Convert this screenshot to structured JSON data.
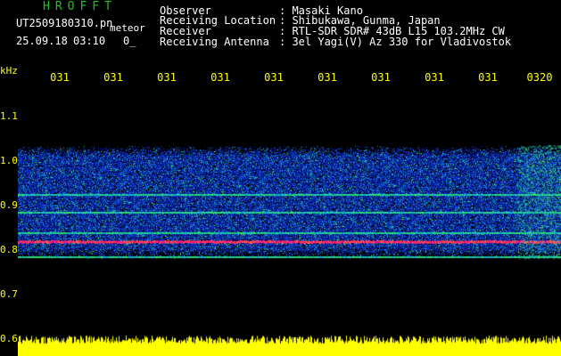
{
  "header": {
    "title": "HROFFT",
    "file_name": "UT2509180310.pn",
    "file_suffix": "meteor",
    "date": "25.09.18",
    "time": "03:10",
    "counter": "0_",
    "fields": [
      {
        "label": "Observer",
        "value": ": Masaki Kano"
      },
      {
        "label": "Receiving Location",
        "value": ": Shibukawa, Gunma, Japan"
      },
      {
        "label": "Receiver",
        "value": ": RTL-SDR SDR# 43dB L15 103.2MHz CW"
      },
      {
        "label": "Receiving Antenna",
        "value": ": 3el Yagi(V) Az 330 for Vladivostok"
      }
    ]
  },
  "axes": {
    "y_unit": "kHz",
    "y_ticks": [
      "1.1",
      "1.0",
      "0.9",
      "0.8",
      "0.7",
      "0.6"
    ],
    "time_ticks": [
      "031",
      "031",
      "031",
      "031",
      "031",
      "031",
      "031",
      "031",
      "031",
      "0320"
    ]
  },
  "colors": {
    "text_green": "#18c818",
    "axis_yellow": "#ffff00",
    "bg": "#000000",
    "band_blue": "#1030c0",
    "signal_red": "#ff2a6a",
    "amplitude_yellow": "#ffff00"
  },
  "spectrum": {
    "band_top_khz": 1.03,
    "band_bottom_khz": 0.775,
    "signal_lines_khz": [
      0.815,
      0.835,
      0.92,
      0.88,
      0.78
    ],
    "red_carrier_khz": 0.815
  }
}
